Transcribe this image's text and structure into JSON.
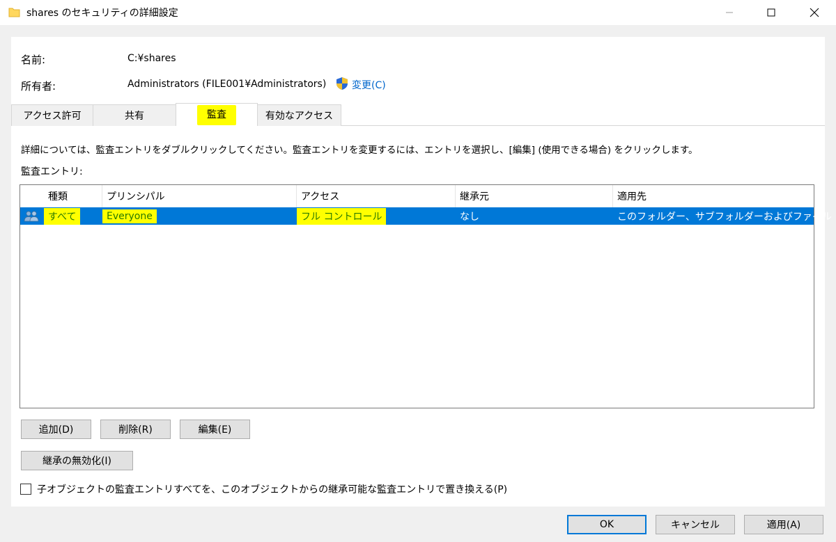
{
  "window": {
    "title": "shares のセキュリティの詳細設定"
  },
  "info": {
    "name_label": "名前:",
    "name_value": "C:¥shares",
    "owner_label": "所有者:",
    "owner_value": "Administrators (FILE001¥Administrators)",
    "change_link": "変更(C)"
  },
  "tabs": [
    {
      "label": "アクセス許可"
    },
    {
      "label": "共有"
    },
    {
      "label": "監査"
    },
    {
      "label": "有効なアクセス"
    }
  ],
  "content": {
    "description": "詳細については、監査エントリをダブルクリックしてください。監査エントリを変更するには、エントリを選択し、[編集] (使用できる場合) をクリックします。",
    "entries_label": "監査エントリ:"
  },
  "table": {
    "columns": [
      "種類",
      "プリンシパル",
      "アクセス",
      "継承元",
      "適用先"
    ],
    "rows": [
      {
        "type": "すべて",
        "principal": "Everyone",
        "access": "フル コントロール",
        "inherited_from": "なし",
        "applies_to": "このフォルダー、サブフォルダーおよびファイル"
      }
    ]
  },
  "buttons": {
    "add": "追加(D)",
    "remove": "削除(R)",
    "edit": "編集(E)",
    "disable_inheritance": "継承の無効化(I)",
    "ok": "OK",
    "cancel": "キャンセル",
    "apply": "適用(A)"
  },
  "checkbox": {
    "label": "子オブジェクトの監査エントリすべてを、このオブジェクトからの継承可能な監査エントリで置き換える(P)",
    "checked": false
  },
  "colors": {
    "selection": "#0078d7",
    "highlight": "#ffff00",
    "link": "#0066cc"
  }
}
